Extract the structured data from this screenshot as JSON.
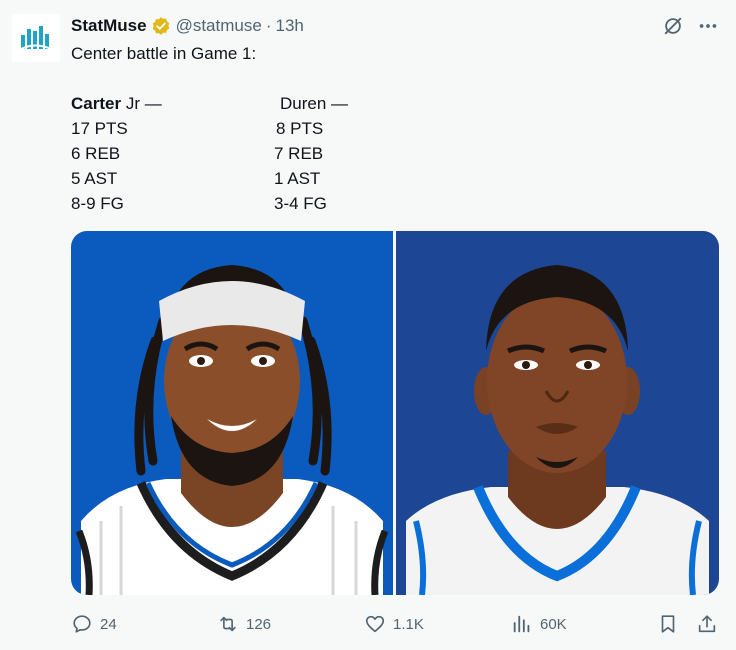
{
  "author": {
    "display_name": "StatMuse",
    "handle": "@statmuse",
    "separator": "·",
    "time": "13h"
  },
  "tweet": {
    "intro": "Center battle in Game 1:",
    "left": {
      "name_bold": "Carter",
      "name_rest": " Jr —",
      "stats": [
        "17 PTS",
        "6 REB",
        "5 AST",
        "8-9 FG"
      ]
    },
    "right": {
      "name": "Duren —",
      "stats": [
        "8 PTS",
        "7 REB",
        "1 AST",
        "3-4 FG"
      ]
    }
  },
  "actions": {
    "replies": "24",
    "reposts": "126",
    "likes": "1.1K",
    "views": "60K"
  },
  "icons": {
    "avatar": "statmuse-logo",
    "verified": "verified-badge-icon",
    "grok": "grok-icon",
    "more": "more-icon",
    "reply": "reply-icon",
    "repost": "repost-icon",
    "like": "heart-icon",
    "views": "views-icon",
    "bookmark": "bookmark-icon",
    "share": "share-icon"
  },
  "colors": {
    "background": "#f7f9f9",
    "text": "#0f1419",
    "muted": "#536471",
    "verified": "#e2b719",
    "logo": "#1fa3c9",
    "left_panel": "#0a5bbd",
    "right_panel": "#1d4694"
  }
}
